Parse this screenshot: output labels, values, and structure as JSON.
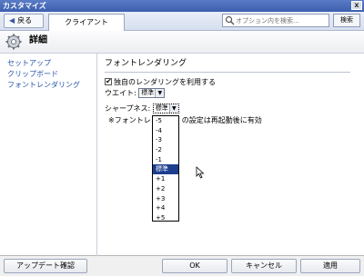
{
  "window": {
    "title": "カスタマイズ",
    "close_glyph": "x"
  },
  "toolbar": {
    "back_label": "戻る",
    "tab_label": "クライアント",
    "search": {
      "placeholder": "オプション内を検索...",
      "value": ""
    },
    "search_button_label": "検索"
  },
  "header": {
    "title": "詳細"
  },
  "sidebar": {
    "items": [
      {
        "label": "セットアップ"
      },
      {
        "label": "クリップボード"
      },
      {
        "label": "フォントレンダリング"
      }
    ]
  },
  "main": {
    "section_title": "フォントレンダリング",
    "use_own_rendering": {
      "label": "独自のレンダリングを利用する",
      "checked": true
    },
    "weight": {
      "label": "ウエイト:",
      "value": "標準"
    },
    "sharpness": {
      "label": "シャープネス:",
      "value": "標準",
      "expanded": true
    },
    "note_prefix": "※フォントレン",
    "note_suffix": "の設定は再起動後に有効",
    "sharpness_options": [
      "-5",
      "-4",
      "-3",
      "-2",
      "-1",
      "標準",
      "+1",
      "+2",
      "+3",
      "+4",
      "+5"
    ],
    "sharpness_selected_index": 5
  },
  "footer": {
    "update_check_label": "アップデート確認",
    "ok_label": "OK",
    "cancel_label": "キャンセル",
    "apply_label": "適用"
  },
  "colors": {
    "title_bar": "#4a6cbc",
    "link": "#2753a8",
    "selection": "#1d3e8f"
  }
}
